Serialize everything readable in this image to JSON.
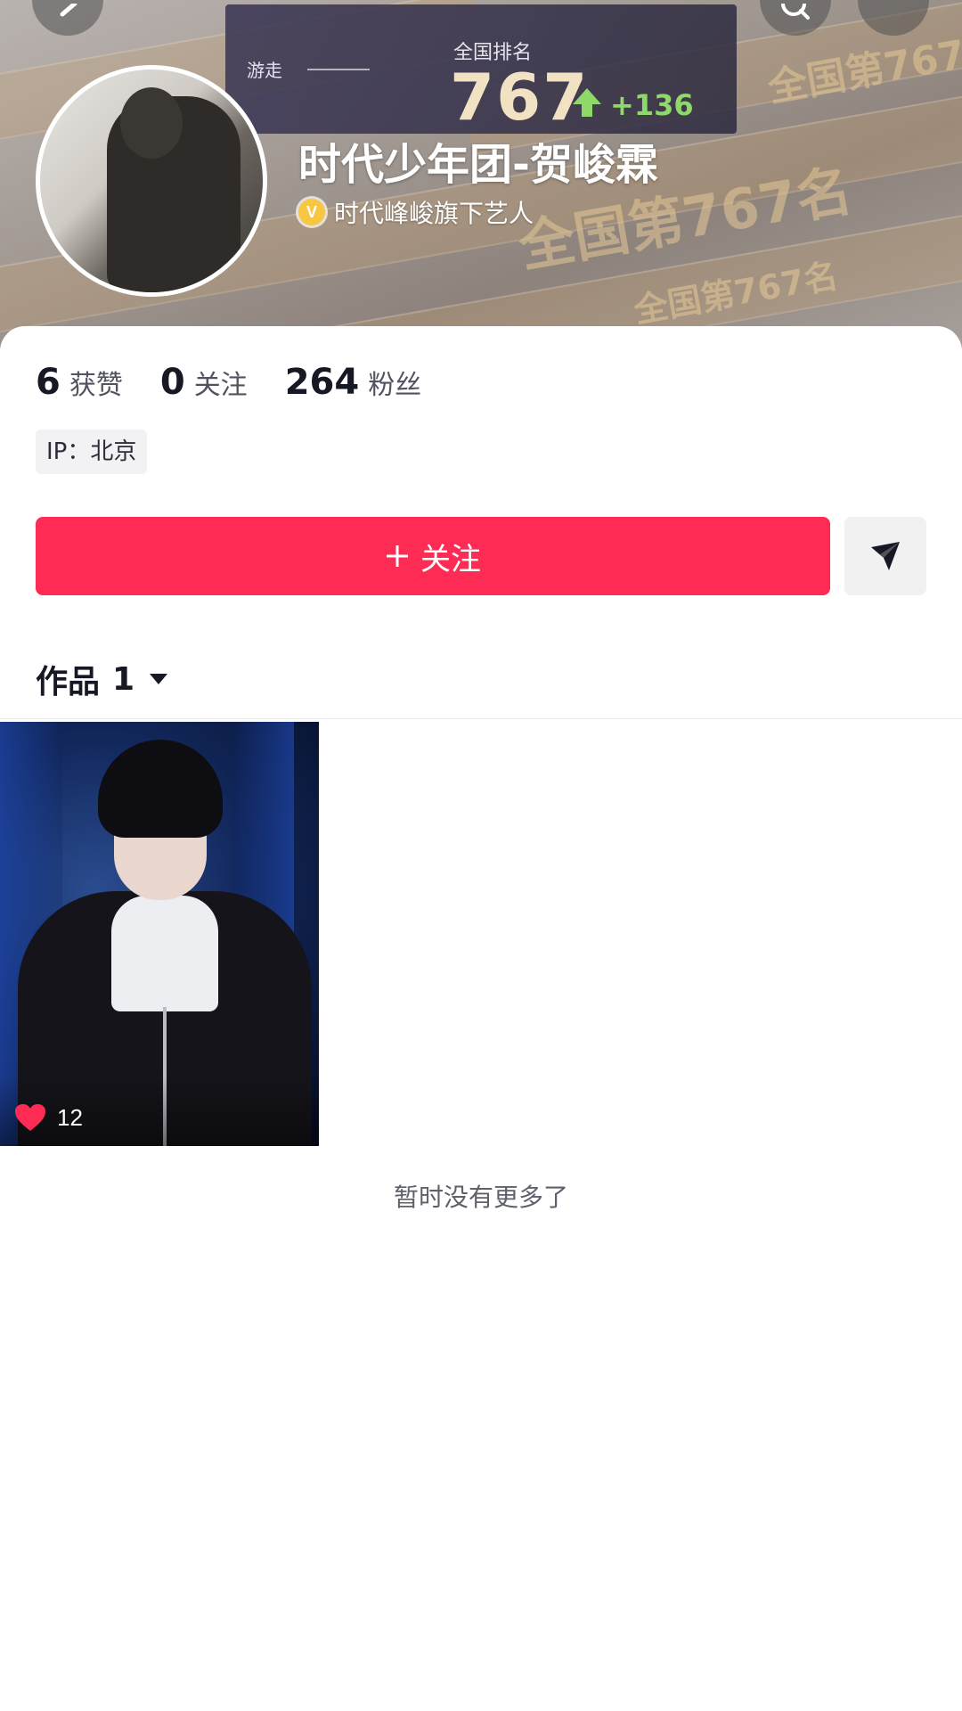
{
  "header": {
    "rank_banner": {
      "wander_label": "游走",
      "rank_label": "全国排名",
      "rank_value": "767",
      "rank_change": "+136"
    },
    "background_text": "全国第767名",
    "profile_name": "时代少年团-贺峻霖",
    "verification": {
      "badge_letter": "V",
      "text": "时代峰峻旗下艺人"
    }
  },
  "stats": [
    {
      "value": "6",
      "label": "获赞"
    },
    {
      "value": "0",
      "label": "关注"
    },
    {
      "value": "264",
      "label": "粉丝"
    }
  ],
  "ip_location": "IP：北京",
  "actions": {
    "follow_label": "关注",
    "share_icon": "send-icon"
  },
  "works_tab": {
    "label": "作品",
    "count": "1"
  },
  "videos": [
    {
      "likes": "12"
    }
  ],
  "footer_text": "暂时没有更多了",
  "colors": {
    "accent": "#fe2c55",
    "like": "#fe2c55",
    "rank_up": "#8fd86a",
    "verify_badge": "#f7c744"
  }
}
